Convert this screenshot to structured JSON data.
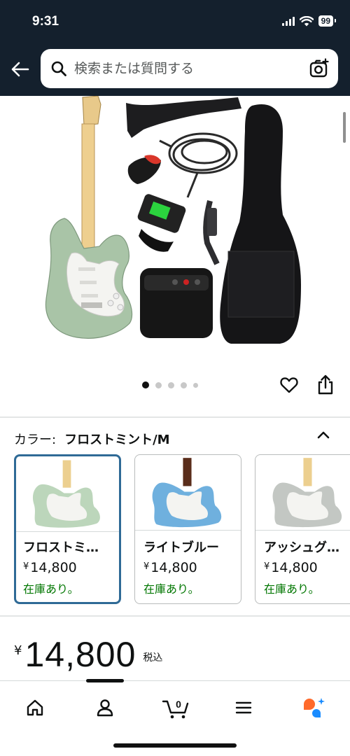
{
  "status_bar": {
    "time": "9:31",
    "battery": "99"
  },
  "search": {
    "placeholder": "検索または質問する"
  },
  "gallery": {
    "image_count": 5,
    "active_index": 0
  },
  "color_selector": {
    "label": "カラー:",
    "selected": "フロストミント/M",
    "options": [
      {
        "name": "フロストミ…",
        "yen": "¥",
        "price": "14,800",
        "stock": "在庫あり。",
        "color": "#bcd6bb",
        "selected": true
      },
      {
        "name": "ライトブルー",
        "yen": "¥",
        "price": "14,800",
        "stock": "在庫あり。",
        "color": "#6fb0de",
        "selected": false
      },
      {
        "name": "アッシュグ…",
        "yen": "¥",
        "price": "14,800",
        "stock": "在庫あり。",
        "color": "#c3c7c3",
        "selected": false
      }
    ]
  },
  "price": {
    "yen": "¥",
    "value": "14,800",
    "tax": "税込"
  },
  "cart": {
    "count": "0"
  },
  "colors": {
    "header_bg": "#14202d",
    "stock_green": "#007600",
    "selected_border": "#2f6a96",
    "assistant_orange": "#ff6a2b",
    "assistant_blue": "#1a8cff"
  },
  "icons": [
    "arrow-left-icon",
    "search-icon",
    "camera-search-icon",
    "heart-icon",
    "share-icon",
    "chevron-up-icon",
    "home-icon",
    "account-icon",
    "cart-icon",
    "menu-icon",
    "assistant-icon"
  ]
}
